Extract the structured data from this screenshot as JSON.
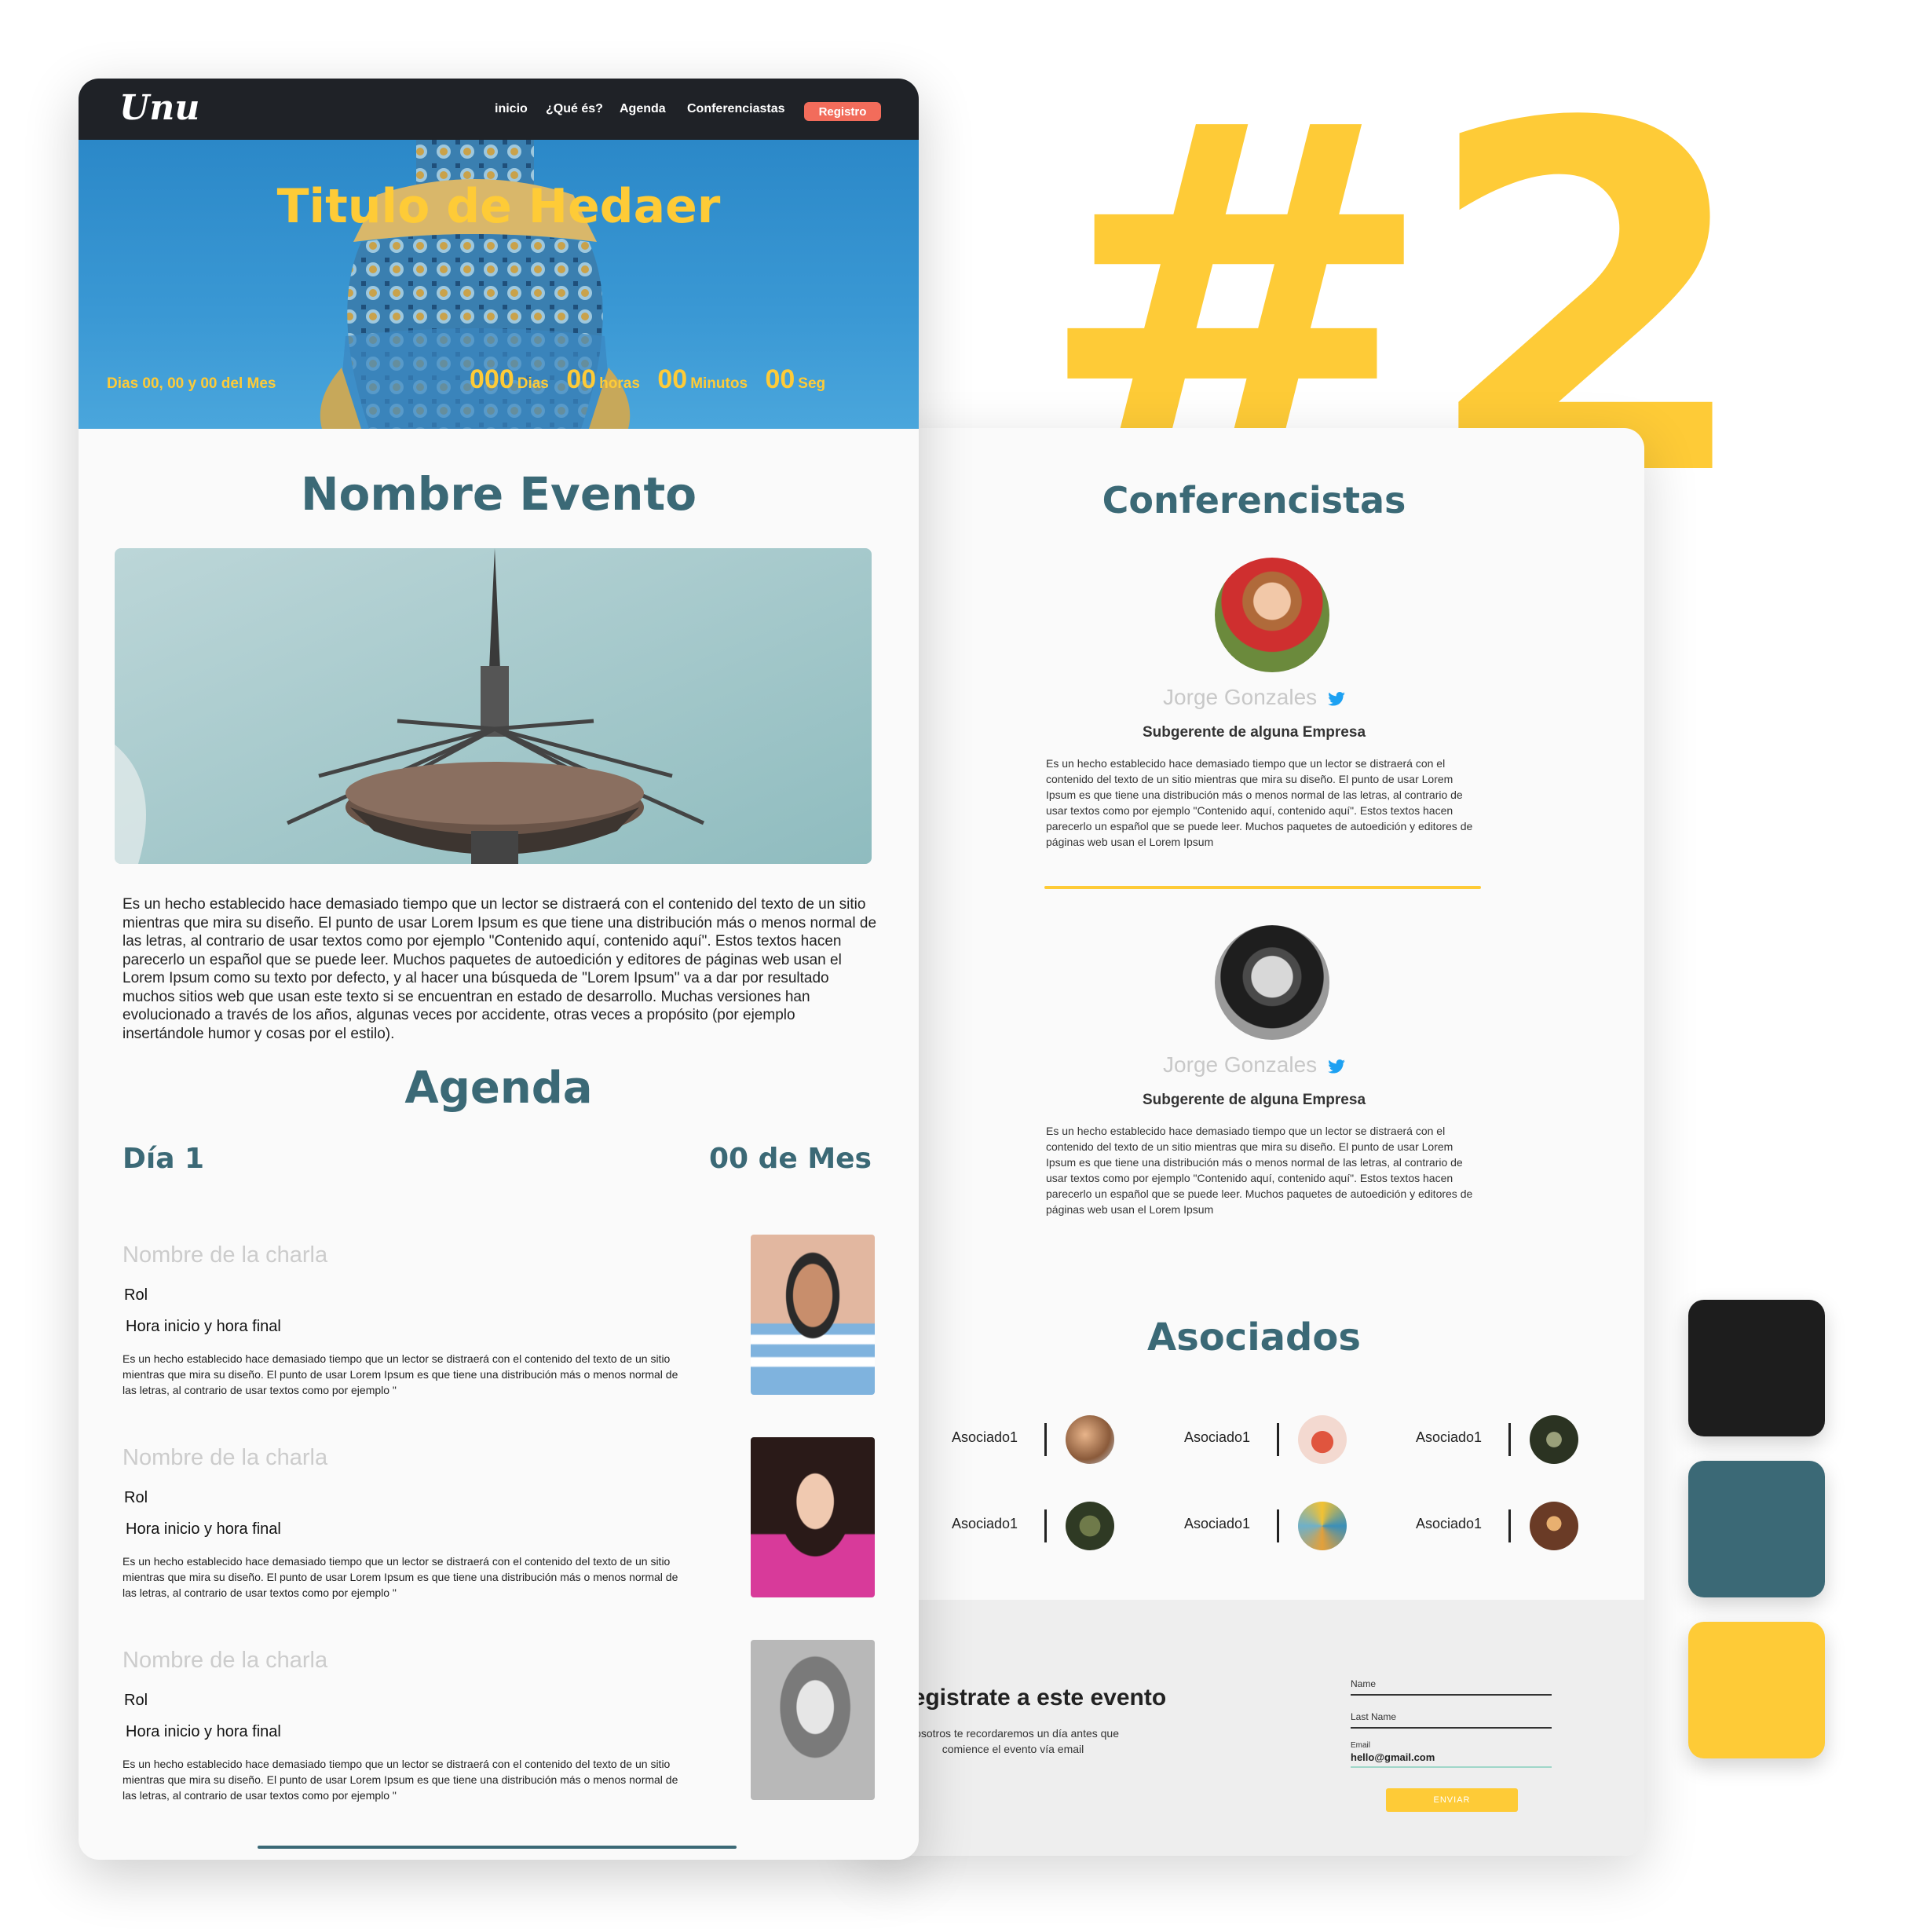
{
  "badge": "#2",
  "nav": {
    "logo": "Unu",
    "items": [
      "inicio",
      "¿Qué és?",
      "Agenda",
      "Conferenciastas"
    ],
    "register": "Registro"
  },
  "hero": {
    "title": "Titulo de Hedaer",
    "date": "Dias 00, 00 y 00 del Mes",
    "countdown": [
      {
        "value": "000",
        "unit": "Dias"
      },
      {
        "value": "00",
        "unit": "horas"
      },
      {
        "value": "00",
        "unit": "Minutos"
      },
      {
        "value": "00",
        "unit": "Seg"
      }
    ]
  },
  "event": {
    "title": "Nombre Evento",
    "text": "Es un hecho establecido hace demasiado tiempo que un lector se distraerá con el contenido del texto de un sitio mientras que mira su diseño. El punto de usar Lorem Ipsum es que tiene una distribución más o menos normal de las letras, al contrario de usar textos como por ejemplo \"Contenido aquí, contenido aquí\". Estos textos hacen parecerlo un español que se puede leer. Muchos paquetes de autoedición y editores de páginas web usan el Lorem Ipsum como su texto por defecto, y al hacer una búsqueda de \"Lorem Ipsum\" va a dar por resultado muchos sitios web que usan este texto si se encuentran en estado de desarrollo. Muchas versiones han evolucionado a través de los años, algunas veces por accidente, otras veces a propósito (por ejemplo insertándole humor y cosas por el estilo)."
  },
  "agenda": {
    "title": "Agenda",
    "day": "Día 1",
    "date": "00 de Mes",
    "talks": [
      {
        "name": "Nombre de la charla",
        "rol": "Rol",
        "hora": "Hora inicio y hora final",
        "desc": "Es un hecho establecido hace demasiado tiempo que un lector se distraerá con el contenido del texto de un sitio mientras que mira su diseño. El punto de usar Lorem Ipsum es que tiene una distribución más o menos normal de las letras, al contrario de usar textos como por ejemplo \""
      },
      {
        "name": "Nombre de la charla",
        "rol": "Rol",
        "hora": "Hora inicio y hora final",
        "desc": "Es un hecho establecido hace demasiado tiempo que un lector se distraerá con el contenido del texto de un sitio mientras que mira su diseño. El punto de usar Lorem Ipsum es que tiene una distribución más o menos normal de las letras, al contrario de usar textos como por ejemplo \""
      },
      {
        "name": "Nombre de la charla",
        "rol": "Rol",
        "hora": "Hora inicio y hora final",
        "desc": "Es un hecho establecido hace demasiado tiempo que un lector se distraerá con el contenido del texto de un sitio mientras que mira su diseño. El punto de usar Lorem Ipsum es que tiene una distribución más o menos normal de las letras, al contrario de usar textos como por ejemplo \""
      }
    ]
  },
  "speakers": {
    "title": "Conferencistas",
    "list": [
      {
        "name": "Jorge Gonzales",
        "role": "Subgerente de alguna Empresa",
        "desc": "Es un hecho establecido hace demasiado tiempo que un lector se distraerá con el contenido del texto de un sitio mientras que mira su diseño. El punto de usar Lorem Ipsum es que tiene una distribución más o menos normal de las letras, al contrario de usar textos como por ejemplo \"Contenido aquí, contenido aquí\". Estos textos hacen parecerlo un español que se puede leer. Muchos paquetes de autoedición y editores de páginas web usan el Lorem Ipsum"
      },
      {
        "name": "Jorge Gonzales",
        "role": "Subgerente de alguna Empresa",
        "desc": "Es un hecho establecido hace demasiado tiempo que un lector se distraerá con el contenido del texto de un sitio mientras que mira su diseño. El punto de usar Lorem Ipsum es que tiene una distribución más o menos normal de las letras, al contrario de usar textos como por ejemplo \"Contenido aquí, contenido aquí\". Estos textos hacen parecerlo un español que se puede leer. Muchos paquetes de autoedición y editores de páginas web usan el Lorem Ipsum"
      }
    ]
  },
  "partners": {
    "title": "Asociados",
    "items": [
      "Asociado1",
      "Asociado1",
      "Asociado1",
      "Asociado1",
      "Asociado1",
      "Asociado1"
    ]
  },
  "register": {
    "title": "Registrate a este evento",
    "subtitle": "Nosotros te recordaremos un día antes que comience el evento vía email",
    "fields": {
      "name_label": "Name",
      "lastname_label": "Last Name",
      "email_label": "Email",
      "email_value": "hello@gmail.com"
    },
    "submit": "ENVIAR"
  },
  "palette": [
    "#1d1d1d",
    "#3b6976",
    "#fecb37"
  ]
}
